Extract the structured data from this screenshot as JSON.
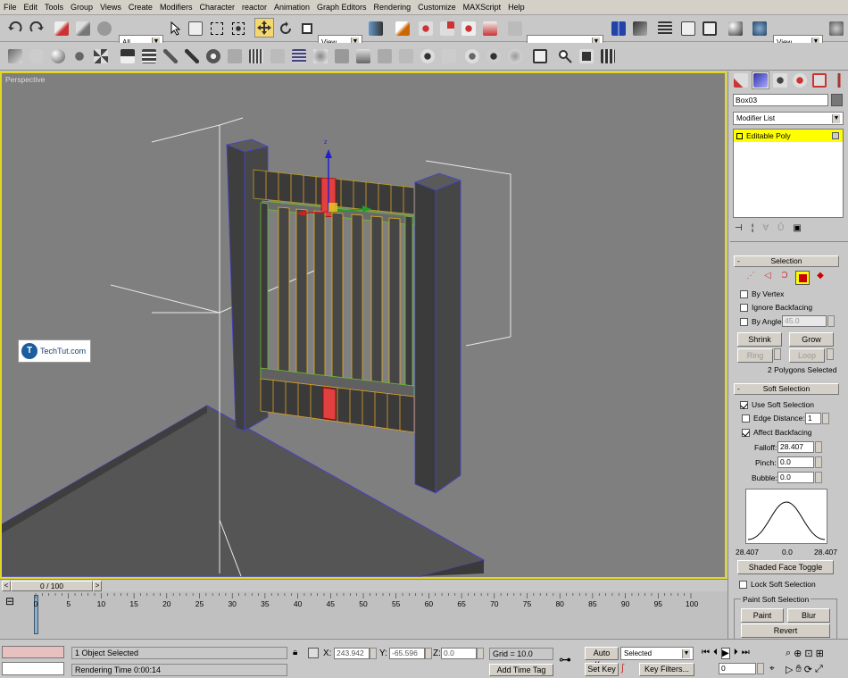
{
  "menu": [
    "File",
    "Edit",
    "Tools",
    "Group",
    "Views",
    "Create",
    "Modifiers",
    "Character",
    "reactor",
    "Animation",
    "Graph Editors",
    "Rendering",
    "Customize",
    "MAXScript",
    "Help"
  ],
  "toolbar1": {
    "filter_value": "All",
    "ref_coord": "View",
    "named_sel": "",
    "view_right": "View"
  },
  "viewport": {
    "label": "Perspective",
    "watermark": "TechTut.com",
    "axis_label": "z"
  },
  "panel": {
    "object_name": "Box03",
    "modifier_list": "Modifier List",
    "stack_item": "Editable Poly",
    "selection": {
      "title": "Selection",
      "by_vertex": "By Vertex",
      "ignore_backfacing": "Ignore Backfacing",
      "by_angle": "By Angle:",
      "by_angle_value": "45.0",
      "shrink": "Shrink",
      "grow": "Grow",
      "ring": "Ring",
      "loop": "Loop",
      "status": "2 Polygons Selected"
    },
    "soft": {
      "title": "Soft Selection",
      "use_soft": "Use Soft Selection",
      "edge_distance": "Edge Distance:",
      "edge_distance_value": "1",
      "affect_backfacing": "Affect Backfacing",
      "falloff": "Falloff:",
      "falloff_value": "28.407",
      "pinch": "Pinch:",
      "pinch_value": "0.0",
      "bubble": "Bubble:",
      "bubble_value": "0.0",
      "curve_left": "28.407",
      "curve_mid": "0.0",
      "curve_right": "28.407",
      "shaded_toggle": "Shaded Face Toggle",
      "lock": "Lock Soft Selection",
      "paint_group": "Paint Soft Selection",
      "paint": "Paint",
      "blur": "Blur",
      "revert": "Revert"
    }
  },
  "timeline": {
    "slider": "0 / 100",
    "ticks": [
      "0",
      "5",
      "10",
      "15",
      "20",
      "25",
      "30",
      "35",
      "40",
      "45",
      "50",
      "55",
      "60",
      "65",
      "70",
      "75",
      "80",
      "85",
      "90",
      "95",
      "100"
    ]
  },
  "status": {
    "selected": "1 Object Selected",
    "render_time": "Rendering Time  0:00:14",
    "x_label": "X:",
    "x": "243.942",
    "y_label": "Y:",
    "y": "-65.596",
    "z_label": "Z:",
    "z": "0.0",
    "grid": "Grid = 10.0",
    "add_time_tag": "Add Time Tag",
    "auto_key": "Auto Key",
    "set_key": "Set Key",
    "selected_dd": "Selected",
    "key_filters": "Key Filters...",
    "frame": "0"
  },
  "colors": {
    "viewport_bg": "#808080",
    "selected_yellow": "#ffff00",
    "poly_red": "#e04040"
  }
}
